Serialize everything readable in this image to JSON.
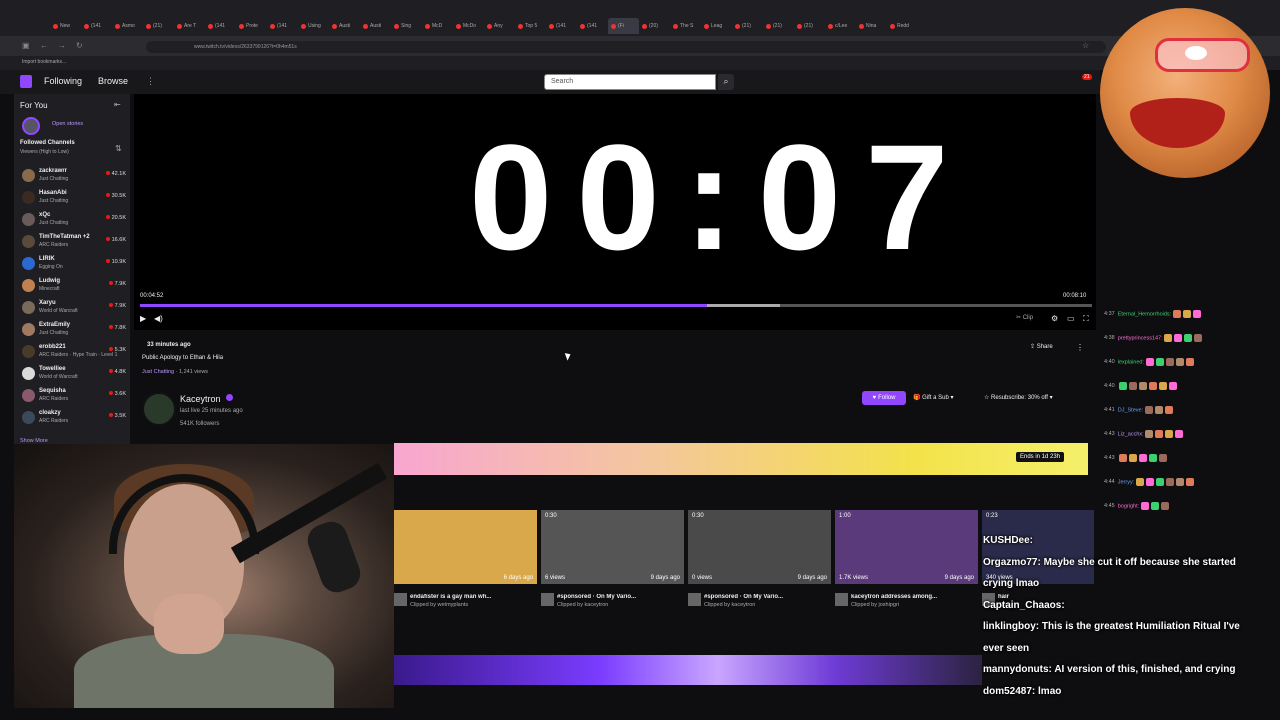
{
  "browser": {
    "tabs": [
      "New",
      "(141",
      "Asmo",
      "(21)",
      "Are T",
      "(141",
      "Prote",
      "(141",
      "Using",
      "Austi",
      "Austi",
      "Sing",
      "McD",
      "McDo",
      "Any",
      "Top 5",
      "(141",
      "(141",
      "(Fi",
      "(20)",
      "The S",
      "Leag",
      "(21)",
      "(21)",
      "(21)",
      "c/Lee",
      "Nina",
      "Redd"
    ],
    "url": "www.twitch.tv/videos/2633799126?t=0h4m51s",
    "bookmarks_label": "Import bookmarks..."
  },
  "topnav": {
    "following": "Following",
    "browse": "Browse",
    "search_placeholder": "Search",
    "notif_count": "21"
  },
  "sidebar": {
    "for_you": "For You",
    "open_stories": "Open stories",
    "followed_title": "Followed Channels",
    "followed_sort": "Viewers (High to Low)",
    "channels": [
      {
        "name": "zackrawrr",
        "game": "Just Chatting",
        "viewers": "42.1K",
        "color": "#8a6a4a"
      },
      {
        "name": "HasanAbi",
        "game": "Just Chatting",
        "viewers": "30.5K",
        "color": "#3a2a20"
      },
      {
        "name": "xQc",
        "game": "Just Chatting",
        "viewers": "20.5K",
        "color": "#6a5a5a"
      },
      {
        "name": "TimTheTatman +2",
        "game": "ARC Raiders",
        "viewers": "16.6K",
        "color": "#5a4a3a"
      },
      {
        "name": "LIRIK",
        "game": "Egging On",
        "viewers": "10.9K",
        "color": "#2a6ad0"
      },
      {
        "name": "Ludwig",
        "game": "Minecraft",
        "viewers": "7.9K",
        "color": "#c08050"
      },
      {
        "name": "Xaryu",
        "game": "World of Warcraft",
        "viewers": "7.9K",
        "color": "#7a6a5a"
      },
      {
        "name": "ExtraEmily",
        "game": "Just Chatting",
        "viewers": "7.8K",
        "color": "#a07a60"
      },
      {
        "name": "erobb221",
        "game": "ARC Raiders · Hype Train · Level 1",
        "viewers": "5.3K",
        "color": "#4a3a2a"
      },
      {
        "name": "Towelliee",
        "game": "World of Warcraft",
        "viewers": "4.8K",
        "color": "#dadada"
      },
      {
        "name": "Sequisha",
        "game": "ARC Raiders",
        "viewers": "3.6K",
        "color": "#8a5a6a"
      },
      {
        "name": "cloakzy",
        "game": "ARC Raiders",
        "viewers": "3.5K",
        "color": "#3a4a5a"
      }
    ],
    "show_more": "Show More"
  },
  "video": {
    "overlay_text": "00:07",
    "time_current": "00:04:52",
    "time_total": "00:08:10",
    "progress_fraction": 0.596,
    "clip_label": "Clip"
  },
  "stream": {
    "ago": "33 minutes ago",
    "title": "Public Apology to Ethan & Hila",
    "category": "Just Chatting",
    "views": "· 1,241 views",
    "share_label": "Share"
  },
  "channel": {
    "name": "Kaceytron",
    "live_status": "last live 25 minutes ago",
    "followers": "541K followers",
    "follow_label": "Follow",
    "gift_label": "Gift a Sub",
    "resub_label": "Resubscribe: 30% off"
  },
  "clips_section": {
    "ends_badge": "Ends in 1d 23h",
    "clips": [
      {
        "duration": "",
        "views": "",
        "age": "6 days ago",
        "title": "endafister is a gay man wh...",
        "by": "Clipped by wetmyplants",
        "color": "#d9a84a"
      },
      {
        "duration": "0:30",
        "views": "6 views",
        "age": "9 days ago",
        "title": "#sponsored · On My Vario...",
        "by": "Clipped by kaceytron",
        "color": "#555"
      },
      {
        "duration": "0:30",
        "views": "0 views",
        "age": "9 days ago",
        "title": "#sponsored · On My Vario...",
        "by": "Clipped by kaceytron",
        "color": "#4a4a4a"
      },
      {
        "duration": "1:00",
        "views": "1.7K views",
        "age": "9 days ago",
        "title": "kaceytron addresses among...",
        "by": "Clipped by joshipgri",
        "color": "#5a3a7a"
      },
      {
        "duration": "0:23",
        "views": "340 views",
        "age": "",
        "title": "hair",
        "by": "Kac",
        "color": "#2a2a4a"
      }
    ]
  },
  "side_chat": [
    {
      "time": "4:37",
      "user": "Eternal_Hemorrhoids:",
      "color": "#3bd16f"
    },
    {
      "time": "4:38",
      "user": "prettyprincess147:",
      "color": "#ff6bd6"
    },
    {
      "time": "4:40",
      "user": "lexplained:",
      "color": "#3bd16f"
    },
    {
      "time": "4:40",
      "user": "",
      "color": "#ff4040"
    },
    {
      "time": "4:41",
      "user": "DJ_Steve:",
      "color": "#6aa0ff"
    },
    {
      "time": "4:43",
      "user": "Liz_acchx:",
      "color": "#bf94ff"
    },
    {
      "time": "4:43",
      "user": "",
      "color": "#ff4040"
    },
    {
      "time": "4:44",
      "user": "Jerryy:",
      "color": "#6aa0ff"
    },
    {
      "time": "4:45",
      "user": "bogright:",
      "color": "#ff6bd6"
    }
  ],
  "overlay_chat": [
    {
      "user": "KUSHDee:",
      "text": ""
    },
    {
      "user": "Orgazmo77:",
      "text": "Maybe she cut it off because she started"
    },
    {
      "user": "",
      "text": "crying lmao"
    },
    {
      "user": "Captain_Chaaos:",
      "text": ""
    },
    {
      "user": "linklingboy:",
      "text": "This is the greatest Humiliation Ritual I've"
    },
    {
      "user": "",
      "text": "ever seen"
    },
    {
      "user": "mannydonuts:",
      "text": "AI version of this, finished, and crying"
    },
    {
      "user": "dom52487:",
      "text": "lmao"
    }
  ],
  "colors": {
    "accent": "#9147ff",
    "live": "#e91916"
  }
}
